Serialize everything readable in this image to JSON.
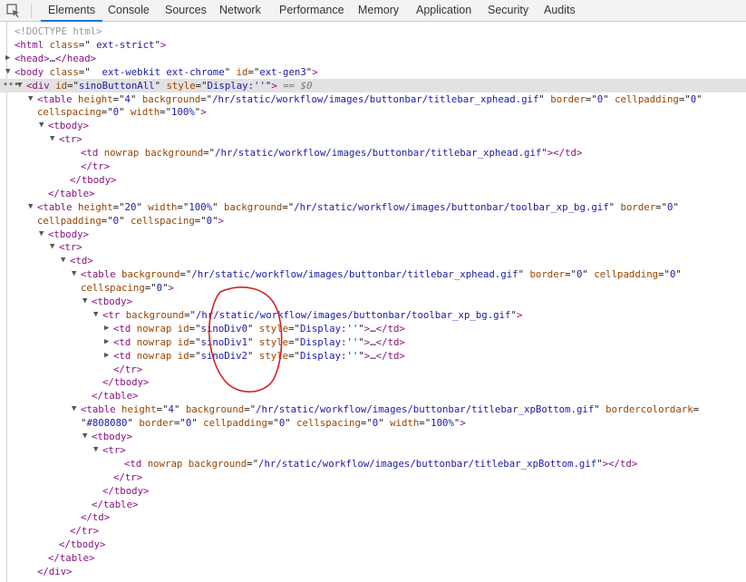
{
  "tabs": [
    "Elements",
    "Console",
    "Sources",
    "Network",
    "Performance",
    "Memory",
    "Application",
    "Security",
    "Audits"
  ],
  "active_tab": "Elements",
  "lines": [
    {
      "tri": "",
      "parts": [
        [
          "cm",
          "<!DOCTYPE html>"
        ]
      ]
    },
    {
      "tri": "",
      "parts": [
        [
          "tag",
          "<html"
        ],
        [
          "t",
          " "
        ],
        [
          "an",
          "class"
        ],
        [
          "t",
          "=\""
        ],
        [
          "av",
          " ext-strict"
        ],
        [
          "t",
          "\""
        ],
        [
          "tag",
          ">"
        ]
      ]
    },
    {
      "tri": "▶",
      "parts": [
        [
          "tag",
          "<head>"
        ],
        [
          "t",
          "…"
        ],
        [
          "tag",
          "</head>"
        ]
      ]
    },
    {
      "tri": "▼",
      "parts": [
        [
          "tag",
          "<body"
        ],
        [
          "t",
          " "
        ],
        [
          "an",
          "class"
        ],
        [
          "t",
          "=\""
        ],
        [
          "av",
          "  ext-webkit ext-chrome"
        ],
        [
          "t",
          "\" "
        ],
        [
          "an",
          "id"
        ],
        [
          "t",
          "=\""
        ],
        [
          "av",
          "ext-gen3"
        ],
        [
          "t",
          "\""
        ],
        [
          "tag",
          ">"
        ]
      ]
    },
    {
      "tri": "▼",
      "parts": [
        [
          "tag",
          "<div"
        ],
        [
          "t",
          " "
        ],
        [
          "an",
          "id"
        ],
        [
          "t",
          "=\""
        ],
        [
          "av",
          "sinoButtonAll"
        ],
        [
          "t",
          "\" "
        ],
        [
          "an",
          "style"
        ],
        [
          "t",
          "=\""
        ],
        [
          "av",
          "Display:''"
        ],
        [
          "t",
          "\""
        ],
        [
          "tag",
          ">"
        ],
        [
          "t",
          " "
        ],
        [
          "dim",
          "== $0"
        ]
      ]
    },
    {
      "tri": "▼",
      "parts": [
        [
          "tag",
          "<table"
        ],
        [
          "t",
          " "
        ],
        [
          "an",
          "height"
        ],
        [
          "t",
          "=\""
        ],
        [
          "av",
          "4"
        ],
        [
          "t",
          "\" "
        ],
        [
          "an",
          "background"
        ],
        [
          "t",
          "=\""
        ],
        [
          "av",
          "/hr/static/workflow/images/buttonbar/titlebar_xphead.gif"
        ],
        [
          "t",
          "\" "
        ],
        [
          "an",
          "border"
        ],
        [
          "t",
          "=\""
        ],
        [
          "av",
          "0"
        ],
        [
          "t",
          "\" "
        ],
        [
          "an",
          "cellpadding"
        ],
        [
          "t",
          "=\""
        ],
        [
          "av",
          "0"
        ],
        [
          "t",
          "\""
        ]
      ]
    },
    {
      "tri": "",
      "parts": [
        [
          "an",
          "cellspacing"
        ],
        [
          "t",
          "=\""
        ],
        [
          "av",
          "0"
        ],
        [
          "t",
          "\" "
        ],
        [
          "an",
          "width"
        ],
        [
          "t",
          "=\""
        ],
        [
          "av",
          "100%"
        ],
        [
          "t",
          "\""
        ],
        [
          "tag",
          ">"
        ]
      ]
    },
    {
      "tri": "▼",
      "parts": [
        [
          "tag",
          "<tbody>"
        ]
      ]
    },
    {
      "tri": "▼",
      "parts": [
        [
          "tag",
          "<tr>"
        ]
      ]
    },
    {
      "tri": "",
      "parts": [
        [
          "tag",
          "<td"
        ],
        [
          "t",
          " "
        ],
        [
          "an",
          "nowrap"
        ],
        [
          "t",
          " "
        ],
        [
          "an",
          "background"
        ],
        [
          "t",
          "=\""
        ],
        [
          "av",
          "/hr/static/workflow/images/buttonbar/titlebar_xphead.gif"
        ],
        [
          "t",
          "\""
        ],
        [
          "tag",
          ">"
        ],
        [
          "tag",
          "</td>"
        ]
      ]
    },
    {
      "tri": "",
      "parts": [
        [
          "tag",
          "</tr>"
        ]
      ]
    },
    {
      "tri": "",
      "parts": [
        [
          "tag",
          "</tbody>"
        ]
      ]
    },
    {
      "tri": "",
      "parts": [
        [
          "tag",
          "</table>"
        ]
      ]
    },
    {
      "tri": "▼",
      "parts": [
        [
          "tag",
          "<table"
        ],
        [
          "t",
          " "
        ],
        [
          "an",
          "height"
        ],
        [
          "t",
          "=\""
        ],
        [
          "av",
          "20"
        ],
        [
          "t",
          "\" "
        ],
        [
          "an",
          "width"
        ],
        [
          "t",
          "=\""
        ],
        [
          "av",
          "100%"
        ],
        [
          "t",
          "\" "
        ],
        [
          "an",
          "background"
        ],
        [
          "t",
          "=\""
        ],
        [
          "av",
          "/hr/static/workflow/images/buttonbar/toolbar_xp_bg.gif"
        ],
        [
          "t",
          "\" "
        ],
        [
          "an",
          "border"
        ],
        [
          "t",
          "=\""
        ],
        [
          "av",
          "0"
        ],
        [
          "t",
          "\""
        ]
      ]
    },
    {
      "tri": "",
      "parts": [
        [
          "an",
          "cellpadding"
        ],
        [
          "t",
          "=\""
        ],
        [
          "av",
          "0"
        ],
        [
          "t",
          "\" "
        ],
        [
          "an",
          "cellspacing"
        ],
        [
          "t",
          "=\""
        ],
        [
          "av",
          "0"
        ],
        [
          "t",
          "\""
        ],
        [
          "tag",
          ">"
        ]
      ]
    },
    {
      "tri": "▼",
      "parts": [
        [
          "tag",
          "<tbody>"
        ]
      ]
    },
    {
      "tri": "▼",
      "parts": [
        [
          "tag",
          "<tr>"
        ]
      ]
    },
    {
      "tri": "▼",
      "parts": [
        [
          "tag",
          "<td>"
        ]
      ]
    },
    {
      "tri": "▼",
      "parts": [
        [
          "tag",
          "<table"
        ],
        [
          "t",
          " "
        ],
        [
          "an",
          "background"
        ],
        [
          "t",
          "=\""
        ],
        [
          "av",
          "/hr/static/workflow/images/buttonbar/titlebar_xphead.gif"
        ],
        [
          "t",
          "\" "
        ],
        [
          "an",
          "border"
        ],
        [
          "t",
          "=\""
        ],
        [
          "av",
          "0"
        ],
        [
          "t",
          "\" "
        ],
        [
          "an",
          "cellpadding"
        ],
        [
          "t",
          "=\""
        ],
        [
          "av",
          "0"
        ],
        [
          "t",
          "\""
        ]
      ]
    },
    {
      "tri": "",
      "parts": [
        [
          "an",
          "cellspacing"
        ],
        [
          "t",
          "=\""
        ],
        [
          "av",
          "0"
        ],
        [
          "t",
          "\""
        ],
        [
          "tag",
          ">"
        ]
      ]
    },
    {
      "tri": "▼",
      "parts": [
        [
          "tag",
          "<tbody>"
        ]
      ]
    },
    {
      "tri": "▼",
      "parts": [
        [
          "tag",
          "<tr"
        ],
        [
          "t",
          " "
        ],
        [
          "an",
          "background"
        ],
        [
          "t",
          "=\""
        ],
        [
          "av",
          "/hr/static/workflow/images/buttonbar/toolbar_xp_bg.gif"
        ],
        [
          "t",
          "\""
        ],
        [
          "tag",
          ">"
        ]
      ]
    },
    {
      "tri": "▶",
      "parts": [
        [
          "tag",
          "<td"
        ],
        [
          "t",
          " "
        ],
        [
          "an",
          "nowrap"
        ],
        [
          "t",
          " "
        ],
        [
          "an",
          "id"
        ],
        [
          "t",
          "=\""
        ],
        [
          "av",
          "sinoDiv0"
        ],
        [
          "t",
          "\" "
        ],
        [
          "an",
          "style"
        ],
        [
          "t",
          "=\""
        ],
        [
          "av",
          "Display:''"
        ],
        [
          "t",
          "\""
        ],
        [
          "tag",
          ">"
        ],
        [
          "t",
          "…"
        ],
        [
          "tag",
          "</td>"
        ]
      ]
    },
    {
      "tri": "▶",
      "parts": [
        [
          "tag",
          "<td"
        ],
        [
          "t",
          " "
        ],
        [
          "an",
          "nowrap"
        ],
        [
          "t",
          " "
        ],
        [
          "an",
          "id"
        ],
        [
          "t",
          "=\""
        ],
        [
          "av",
          "sinoDiv1"
        ],
        [
          "t",
          "\" "
        ],
        [
          "an",
          "style"
        ],
        [
          "t",
          "=\""
        ],
        [
          "av",
          "Display:''"
        ],
        [
          "t",
          "\""
        ],
        [
          "tag",
          ">"
        ],
        [
          "t",
          "…"
        ],
        [
          "tag",
          "</td>"
        ]
      ]
    },
    {
      "tri": "▶",
      "parts": [
        [
          "tag",
          "<td"
        ],
        [
          "t",
          " "
        ],
        [
          "an",
          "nowrap"
        ],
        [
          "t",
          " "
        ],
        [
          "an",
          "id"
        ],
        [
          "t",
          "=\""
        ],
        [
          "av",
          "sinoDiv2"
        ],
        [
          "t",
          "\" "
        ],
        [
          "an",
          "style"
        ],
        [
          "t",
          "=\""
        ],
        [
          "av",
          "Display:''"
        ],
        [
          "t",
          "\""
        ],
        [
          "tag",
          ">"
        ],
        [
          "t",
          "…"
        ],
        [
          "tag",
          "</td>"
        ]
      ]
    },
    {
      "tri": "",
      "parts": [
        [
          "tag",
          "</tr>"
        ]
      ]
    },
    {
      "tri": "",
      "parts": [
        [
          "tag",
          "</tbody>"
        ]
      ]
    },
    {
      "tri": "",
      "parts": [
        [
          "tag",
          "</table>"
        ]
      ]
    },
    {
      "tri": "▼",
      "parts": [
        [
          "tag",
          "<table"
        ],
        [
          "t",
          " "
        ],
        [
          "an",
          "height"
        ],
        [
          "t",
          "=\""
        ],
        [
          "av",
          "4"
        ],
        [
          "t",
          "\" "
        ],
        [
          "an",
          "background"
        ],
        [
          "t",
          "=\""
        ],
        [
          "av",
          "/hr/static/workflow/images/buttonbar/titlebar_xpBottom.gif"
        ],
        [
          "t",
          "\" "
        ],
        [
          "an",
          "bordercolordark"
        ],
        [
          "t",
          "="
        ]
      ]
    },
    {
      "tri": "",
      "parts": [
        [
          "t",
          "\""
        ],
        [
          "av",
          "#808080"
        ],
        [
          "t",
          "\" "
        ],
        [
          "an",
          "border"
        ],
        [
          "t",
          "=\""
        ],
        [
          "av",
          "0"
        ],
        [
          "t",
          "\" "
        ],
        [
          "an",
          "cellpadding"
        ],
        [
          "t",
          "=\""
        ],
        [
          "av",
          "0"
        ],
        [
          "t",
          "\" "
        ],
        [
          "an",
          "cellspacing"
        ],
        [
          "t",
          "=\""
        ],
        [
          "av",
          "0"
        ],
        [
          "t",
          "\" "
        ],
        [
          "an",
          "width"
        ],
        [
          "t",
          "=\""
        ],
        [
          "av",
          "100%"
        ],
        [
          "t",
          "\""
        ],
        [
          "tag",
          ">"
        ]
      ]
    },
    {
      "tri": "▼",
      "parts": [
        [
          "tag",
          "<tbody>"
        ]
      ]
    },
    {
      "tri": "▼",
      "parts": [
        [
          "tag",
          "<tr>"
        ]
      ]
    },
    {
      "tri": "",
      "parts": [
        [
          "tag",
          "<td"
        ],
        [
          "t",
          " "
        ],
        [
          "an",
          "nowrap"
        ],
        [
          "t",
          " "
        ],
        [
          "an",
          "background"
        ],
        [
          "t",
          "=\""
        ],
        [
          "av",
          "/hr/static/workflow/images/buttonbar/titlebar_xpBottom.gif"
        ],
        [
          "t",
          "\""
        ],
        [
          "tag",
          ">"
        ],
        [
          "tag",
          "</td>"
        ]
      ]
    },
    {
      "tri": "",
      "parts": [
        [
          "tag",
          "</tr>"
        ]
      ]
    },
    {
      "tri": "",
      "parts": [
        [
          "tag",
          "</tbody>"
        ]
      ]
    },
    {
      "tri": "",
      "parts": [
        [
          "tag",
          "</table>"
        ]
      ]
    },
    {
      "tri": "",
      "parts": [
        [
          "tag",
          "</td>"
        ]
      ]
    },
    {
      "tri": "",
      "parts": [
        [
          "tag",
          "</tr>"
        ]
      ]
    },
    {
      "tri": "",
      "parts": [
        [
          "tag",
          "</tbody>"
        ]
      ]
    },
    {
      "tri": "",
      "parts": [
        [
          "tag",
          "</table>"
        ]
      ]
    },
    {
      "tri": "",
      "parts": [
        [
          "tag",
          "</div>"
        ]
      ]
    }
  ]
}
